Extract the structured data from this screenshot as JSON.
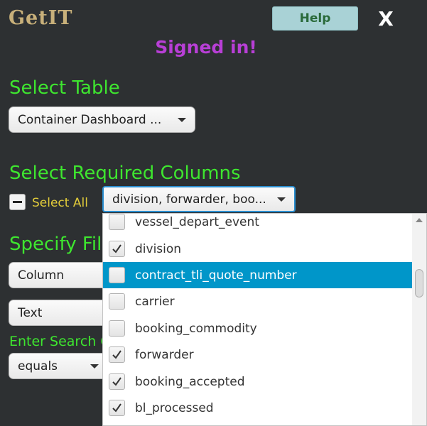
{
  "header": {
    "logo_text": "GetIT",
    "help_label": "Help",
    "close_label": "X",
    "status_text": "Signed in!"
  },
  "select_table": {
    "title": "Select Table",
    "value": "Container Dashboard ..."
  },
  "required_columns": {
    "title": "Select Required Columns",
    "select_all_label": "Select All",
    "columns_value": "division, forwarder, boo..."
  },
  "filter": {
    "title": "Specify Filt",
    "column_value": "Column",
    "type_value": "Text",
    "enter_search_label": "Enter Search C",
    "operator_value": "equals"
  },
  "dropdown": {
    "items": [
      {
        "label": "vessel_depart_event",
        "checked": false,
        "highlighted": false
      },
      {
        "label": "division",
        "checked": true,
        "highlighted": false
      },
      {
        "label": "contract_tli_quote_number",
        "checked": false,
        "highlighted": true
      },
      {
        "label": "carrier",
        "checked": false,
        "highlighted": false
      },
      {
        "label": "booking_commodity",
        "checked": false,
        "highlighted": false
      },
      {
        "label": "forwarder",
        "checked": true,
        "highlighted": false
      },
      {
        "label": "booking_accepted",
        "checked": true,
        "highlighted": false
      },
      {
        "label": "bl_processed",
        "checked": true,
        "highlighted": false
      }
    ]
  },
  "colors": {
    "background": "#2d3032",
    "section_title": "#3ee62f",
    "status": "#b83fd6",
    "select_all": "#e2cc3a",
    "highlight": "#0096c9"
  }
}
